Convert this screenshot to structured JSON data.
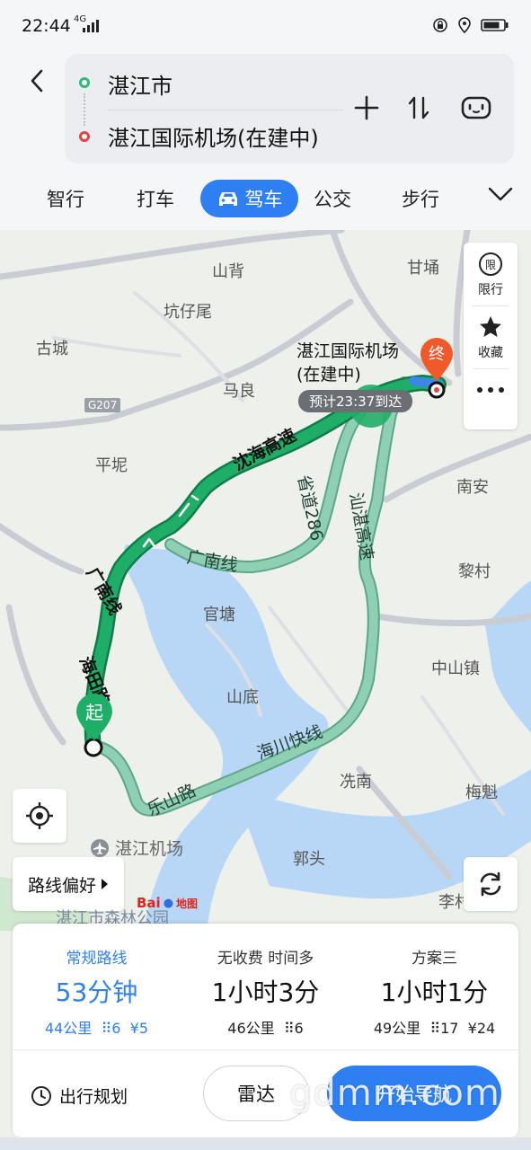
{
  "status_bar": {
    "time": "22:44",
    "network": "4G"
  },
  "route": {
    "origin": "湛江市",
    "destination": "湛江国际机场(在建中)"
  },
  "modes": [
    {
      "label": "智行"
    },
    {
      "label": "打车"
    },
    {
      "label": "驾车",
      "active": true
    },
    {
      "label": "公交"
    },
    {
      "label": "步行"
    }
  ],
  "map": {
    "places": [
      "山背",
      "甘埇",
      "坑仔尾",
      "古城",
      "马良",
      "平坭",
      "南安",
      "官塘",
      "黎村",
      "中山镇",
      "山底",
      "冼南",
      "梅魁",
      "郭头",
      "李村"
    ],
    "road_shield": "G207",
    "road_labels": [
      "沈海高速",
      "广南线",
      "海田路",
      "省道286",
      "汕湛高速",
      "广南线",
      "海川快线",
      "乐山路"
    ],
    "destination_label_line1": "湛江国际机场",
    "destination_label_line2": "(在建中)",
    "eta": "预计23:37到达",
    "start_marker": "起",
    "end_marker": "终",
    "side_tools": [
      {
        "label": "限行",
        "icon": "limit-icon"
      },
      {
        "label": "收藏",
        "icon": "star-icon"
      }
    ],
    "airport_label": "湛江机场",
    "park_label": "湛江市森林公园",
    "route_preference": "路线偏好",
    "logo_text": "Bai",
    "logo_text2": "地图"
  },
  "plans": [
    {
      "title": "常规路线",
      "duration": "53分钟",
      "distance": "44公里",
      "lights": "6",
      "toll": "¥5",
      "selected": true
    },
    {
      "title": "无收费 时间多",
      "duration": "1小时3分",
      "distance": "46公里",
      "lights": "6",
      "toll": "",
      "selected": false
    },
    {
      "title": "方案三",
      "duration": "1小时1分",
      "distance": "49公里",
      "lights": "17",
      "toll": "¥24",
      "selected": false
    }
  ],
  "actions": {
    "trip_plan": "出行规划",
    "radar": "雷达",
    "start_nav": "开始导航"
  },
  "watermark": "gdmm.com",
  "colors": {
    "accent": "#2d7ff2",
    "route_primary": "#1a9d5e",
    "route_alt": "#8fcfb3",
    "start_green": "#1fae67",
    "end_orange": "#f0592a"
  }
}
